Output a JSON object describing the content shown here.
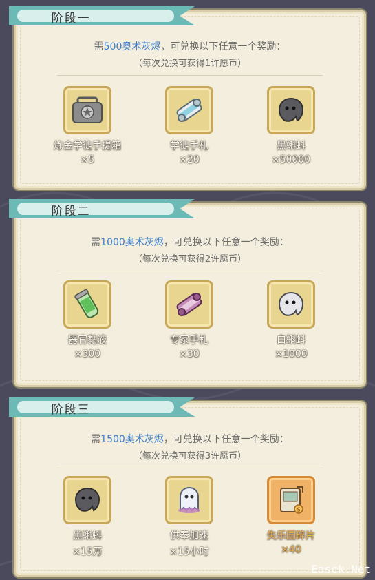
{
  "stages": [
    {
      "title": "阶段一",
      "req_prefix": "需",
      "req_amount": "500奥术灰烬",
      "req_suffix": "，可兑换以下任意一个奖励：",
      "note": "（每次兑换可获得1许愿币）",
      "items": [
        {
          "name": "炼金学徒手提箱",
          "qty": "×5",
          "icon": "briefcase-icon"
        },
        {
          "name": "学徒手札",
          "qty": "×20",
          "icon": "scroll-icon"
        },
        {
          "name": "黑蝌蚪",
          "qty": "×50000",
          "icon": "black-tadpole-icon"
        }
      ]
    },
    {
      "title": "阶段二",
      "req_prefix": "需",
      "req_amount": "1000奥术灰烬",
      "req_suffix": "，可兑换以下任意一个奖励：",
      "note": "（每次兑换可获得2许愿币）",
      "items": [
        {
          "name": "器官黏液",
          "qty": "×300",
          "icon": "slime-tube-icon"
        },
        {
          "name": "专家手札",
          "qty": "×30",
          "icon": "expert-scroll-icon"
        },
        {
          "name": "白蝌蚪",
          "qty": "×1000",
          "icon": "white-tadpole-icon"
        }
      ]
    },
    {
      "title": "阶段三",
      "req_prefix": "需",
      "req_amount": "1500奥术灰烬",
      "req_suffix": "，可兑换以下任意一个奖励：",
      "note": "（每次兑换可获得3许愿币）",
      "items": [
        {
          "name": "黑蝌蚪",
          "qty": "×15万",
          "icon": "black-tadpole-icon"
        },
        {
          "name": "供奉加速",
          "qty": "×15小时",
          "icon": "ghost-speedup-icon"
        },
        {
          "name": "失乐园碎片",
          "qty": "×40",
          "icon": "lost-paradise-fragment-icon"
        }
      ]
    }
  ],
  "watermark": "Easck.Net",
  "colors": {
    "accent_blue": "#3e7fcb",
    "ribbon": "#6db9b6",
    "orange": "#f3b04a"
  }
}
